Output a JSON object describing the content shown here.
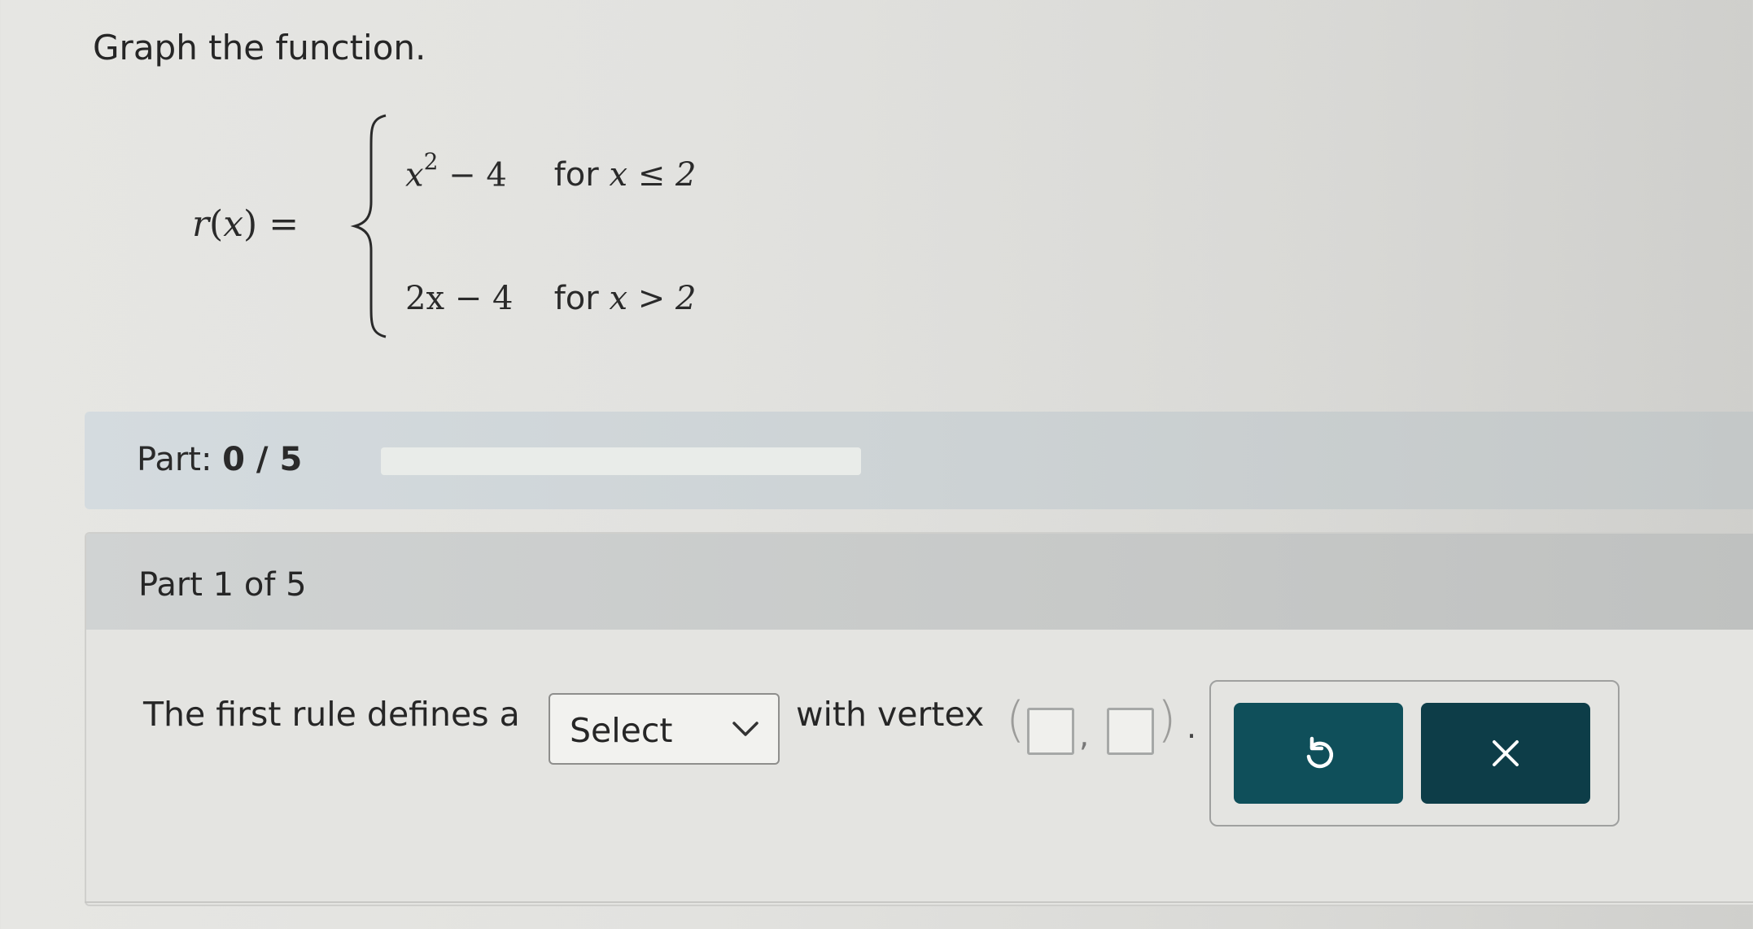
{
  "instruction": "Graph the function.",
  "function": {
    "name": "r",
    "variable": "x",
    "case1": {
      "expr_base": "x",
      "expr_exp": "2",
      "expr_rest": " − 4",
      "cond_kw": "for ",
      "cond": "x ≤ 2"
    },
    "case2": {
      "expr": "2x − 4",
      "cond_kw": "for ",
      "cond": "x > 2"
    }
  },
  "progress": {
    "label": "Part:",
    "value": "0 / 5",
    "fraction": 0
  },
  "part": {
    "header": "Part 1 of 5",
    "question_prefix": "The first rule defines a",
    "select_value": "Select",
    "question_suffix": "with vertex"
  },
  "icons": {
    "undo": "undo-icon",
    "clear": "close-icon",
    "dropdown": "chevron-down-icon"
  },
  "colors": {
    "undo_button": "#0f4f5a",
    "clear_button": "#0d3d48",
    "progress_fill": "#2a7f62"
  }
}
